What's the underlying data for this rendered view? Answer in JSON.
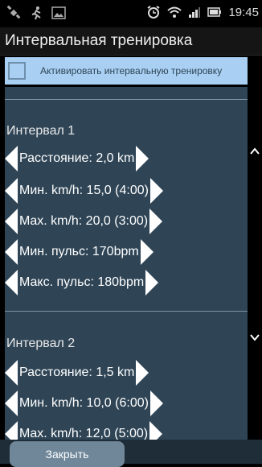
{
  "status_bar": {
    "time": "19:45",
    "icons": [
      "satellite-icon",
      "runner-icon",
      "image-icon",
      "alarm-clock-icon",
      "wifi-icon",
      "signal-icon",
      "battery-icon"
    ]
  },
  "header": {
    "title": "Интервальная тренировка"
  },
  "activate": {
    "label": "Активировать интервальную тренировку",
    "checked": false
  },
  "intervals": [
    {
      "title": "Интервал 1",
      "rows": [
        {
          "label": "Расстояние: 2,0 km"
        },
        {
          "label": "Мин. km/h: 15,0 (4:00)"
        },
        {
          "label": "Max. km/h: 20,0 (3:00)"
        },
        {
          "label": "Мин. пульс: 170bpm"
        },
        {
          "label": "Макс. пульс: 180bpm"
        }
      ]
    },
    {
      "title": "Интервал 2",
      "rows": [
        {
          "label": "Расстояние: 1,5 km"
        },
        {
          "label": "Мин. km/h: 10,0 (6:00)"
        },
        {
          "label": "Max. km/h: 12,0 (5:00)"
        }
      ]
    }
  ],
  "footer": {
    "close_label": "Закрыть"
  },
  "colors": {
    "content_bg": "#2f4556",
    "activate_bg": "#a9cff2",
    "button_bg": "#6f8799"
  }
}
